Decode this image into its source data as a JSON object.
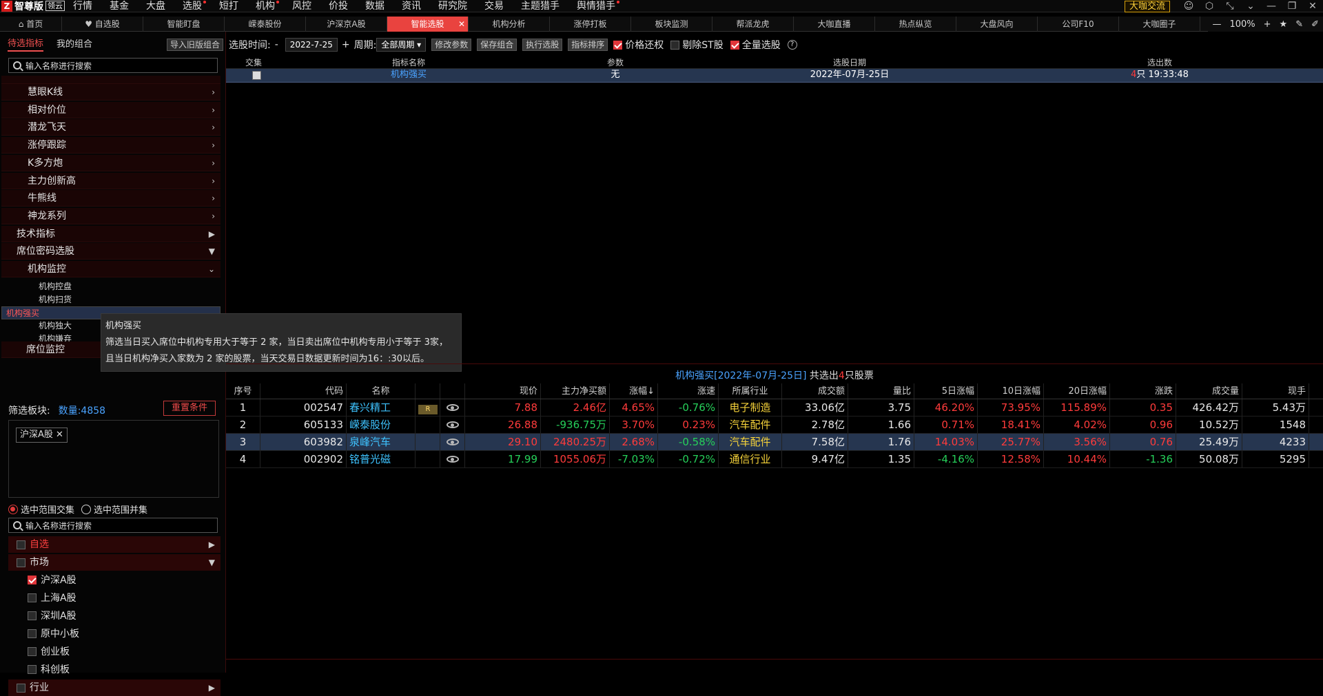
{
  "app": {
    "logo_mark": "Z",
    "name": "智尊版",
    "version": "领云"
  },
  "menus": [
    {
      "label": "行情",
      "dot": false
    },
    {
      "label": "基金",
      "dot": false
    },
    {
      "label": "大盘",
      "dot": false
    },
    {
      "label": "选股",
      "dot": true
    },
    {
      "label": "短打",
      "dot": false
    },
    {
      "label": "机构",
      "dot": true
    },
    {
      "label": "风控",
      "dot": false
    },
    {
      "label": "价投",
      "dot": false
    },
    {
      "label": "数据",
      "dot": false
    },
    {
      "label": "资讯",
      "dot": false
    },
    {
      "label": "研究院",
      "dot": false
    },
    {
      "label": "交易",
      "dot": false
    },
    {
      "label": "主题猎手",
      "dot": false
    },
    {
      "label": "舆情猎手",
      "dot": true
    }
  ],
  "topright": {
    "dakai": "大咖交流",
    "zoom": "100%"
  },
  "tabs": [
    {
      "label": "⌂ 首页",
      "active": false
    },
    {
      "label": "♥ 自选股",
      "active": false
    },
    {
      "label": "智能盯盘",
      "active": false
    },
    {
      "label": "嵘泰股份",
      "active": false
    },
    {
      "label": "沪深京A股",
      "active": false
    },
    {
      "label": "智能选股",
      "active": true
    },
    {
      "label": "机构分析",
      "active": false
    },
    {
      "label": "涨停打板",
      "active": false
    },
    {
      "label": "板块监测",
      "active": false
    },
    {
      "label": "帮派龙虎",
      "active": false
    },
    {
      "label": "大咖直播",
      "active": false
    },
    {
      "label": "热点纵览",
      "active": false
    },
    {
      "label": "大盘风向",
      "active": false
    },
    {
      "label": "公司F10",
      "active": false
    },
    {
      "label": "大咖圈子",
      "active": false
    }
  ],
  "left": {
    "tab_pending": "待选指标",
    "tab_mine": "我的组合",
    "import_btn": "导入旧版组合",
    "search_placeholder": "输入名称进行搜索",
    "tree": [
      {
        "label": "慧眼K线",
        "level": 2,
        "arrow": "›"
      },
      {
        "label": "相对价位",
        "level": 2,
        "arrow": "›"
      },
      {
        "label": "潜龙飞天",
        "level": 2,
        "arrow": "›"
      },
      {
        "label": "涨停跟踪",
        "level": 2,
        "arrow": "›"
      },
      {
        "label": "K多方炮",
        "level": 2,
        "arrow": "›"
      },
      {
        "label": "主力创新高",
        "level": 2,
        "arrow": "›"
      },
      {
        "label": "牛熊线",
        "level": 2,
        "arrow": "›"
      },
      {
        "label": "神龙系列",
        "level": 2,
        "arrow": "›"
      },
      {
        "label": "技术指标",
        "level": 1,
        "arrow": "▶"
      },
      {
        "label": "席位密码选股",
        "level": 1,
        "arrow": "▼"
      },
      {
        "label": "机构监控",
        "level": 2,
        "arrow": "⌄"
      }
    ],
    "leaves": [
      "机构控盘",
      "机构扫货",
      "机构强买",
      "机构独大",
      "机构嫌弃"
    ],
    "leaf_selected": "机构强买",
    "seat_monitor": "席位监控",
    "tooltip": {
      "title": "机构强买",
      "line1": "筛选当日买入席位中机构专用大于等于 2 家，当日卖出席位中机构专用小于等于 3家，",
      "line2": "且当日机构净买入家数为 2 家的股票，当天交易日数据更新时间为16：:30以后。"
    },
    "filter_label": "筛选板块:",
    "filter_count": "数量:4858",
    "reset_btn": "重置条件",
    "chip": "沪深A股 ✕",
    "radio_intersect": "选中范围交集",
    "radio_union": "选中范围并集",
    "search2_placeholder": "输入名称进行搜索",
    "cat_zixuan": "自选",
    "cat_market": "市场",
    "markets": [
      {
        "label": "沪深A股",
        "checked": true
      },
      {
        "label": "上海A股",
        "checked": false
      },
      {
        "label": "深圳A股",
        "checked": false
      },
      {
        "label": "原中小板",
        "checked": false
      },
      {
        "label": "创业板",
        "checked": false
      },
      {
        "label": "科创板",
        "checked": false
      }
    ],
    "cat_industry": "行业"
  },
  "toolbar": {
    "date_label": "选股时间:",
    "minus": "-",
    "date": "2022-7-25",
    "plus": "+",
    "period_label": "周期:",
    "period": "全部周期 ▾",
    "btn_modify": "修改参数",
    "btn_save": "保存组合",
    "btn_exec": "执行选股",
    "btn_sort": "指标排序",
    "chk_price": "价格还权",
    "chk_st": "剔除ST股",
    "chk_all": "全量选股",
    "help": "?"
  },
  "sigtable": {
    "headers": [
      "交集",
      "指标名称",
      "参数",
      "选股日期",
      "选出数"
    ],
    "row": {
      "name": "机构强买",
      "param": "无",
      "date": "2022年-07月-25日",
      "count": "4",
      "count_tail": "只 19:33:48"
    }
  },
  "result": {
    "title_pre": "机构强买[2022年-07月-25日]",
    "title_mid": " 共选出",
    "count": "4",
    "title_post": "只股票"
  },
  "rtable": {
    "headers": [
      "序号",
      "代码",
      "名称",
      "",
      "",
      "现价",
      "主力净买额",
      "涨幅↓",
      "涨速",
      "所属行业",
      "成交额",
      "量比",
      "5日涨幅",
      "10日涨幅",
      "20日涨幅",
      "涨跌",
      "成交量",
      "现手"
    ],
    "rows": [
      {
        "no": "1",
        "code": "002547",
        "name": "春兴精工",
        "badge": "R",
        "price": "7.88",
        "net": "2.46亿",
        "pct": "4.65%",
        "speed": "-0.76%",
        "ind": "电子制造",
        "amt": "33.06亿",
        "vr": "3.75",
        "d5": "46.20%",
        "d10": "73.95%",
        "d20": "115.89%",
        "chg": "0.35",
        "vol": "426.42万",
        "hand": "5.43万"
      },
      {
        "no": "2",
        "code": "605133",
        "name": "嵘泰股份",
        "badge": "",
        "price": "26.88",
        "net": "-936.75万",
        "pct": "3.70%",
        "speed": "0.23%",
        "ind": "汽车配件",
        "amt": "2.78亿",
        "vr": "1.66",
        "d5": "0.71%",
        "d10": "18.41%",
        "d20": "4.02%",
        "chg": "0.96",
        "vol": "10.52万",
        "hand": "1548"
      },
      {
        "no": "3",
        "code": "603982",
        "name": "泉峰汽车",
        "badge": "",
        "price": "29.10",
        "net": "2480.25万",
        "pct": "2.68%",
        "speed": "-0.58%",
        "ind": "汽车配件",
        "amt": "7.58亿",
        "vr": "1.76",
        "d5": "14.03%",
        "d10": "25.77%",
        "d20": "3.56%",
        "chg": "0.76",
        "vol": "25.49万",
        "hand": "4233"
      },
      {
        "no": "4",
        "code": "002902",
        "name": "铭普光磁",
        "badge": "",
        "price": "17.99",
        "net": "1055.06万",
        "pct": "-7.03%",
        "speed": "-0.72%",
        "ind": "通信行业",
        "amt": "9.47亿",
        "vr": "1.35",
        "d5": "-4.16%",
        "d10": "12.58%",
        "d20": "10.44%",
        "chg": "-1.36",
        "vol": "50.08万",
        "hand": "5295"
      }
    ]
  },
  "colors": {
    "accent": "#e9433f",
    "up": "#ff3b3b",
    "down": "#26d05a",
    "blue": "#4aa3ff"
  }
}
